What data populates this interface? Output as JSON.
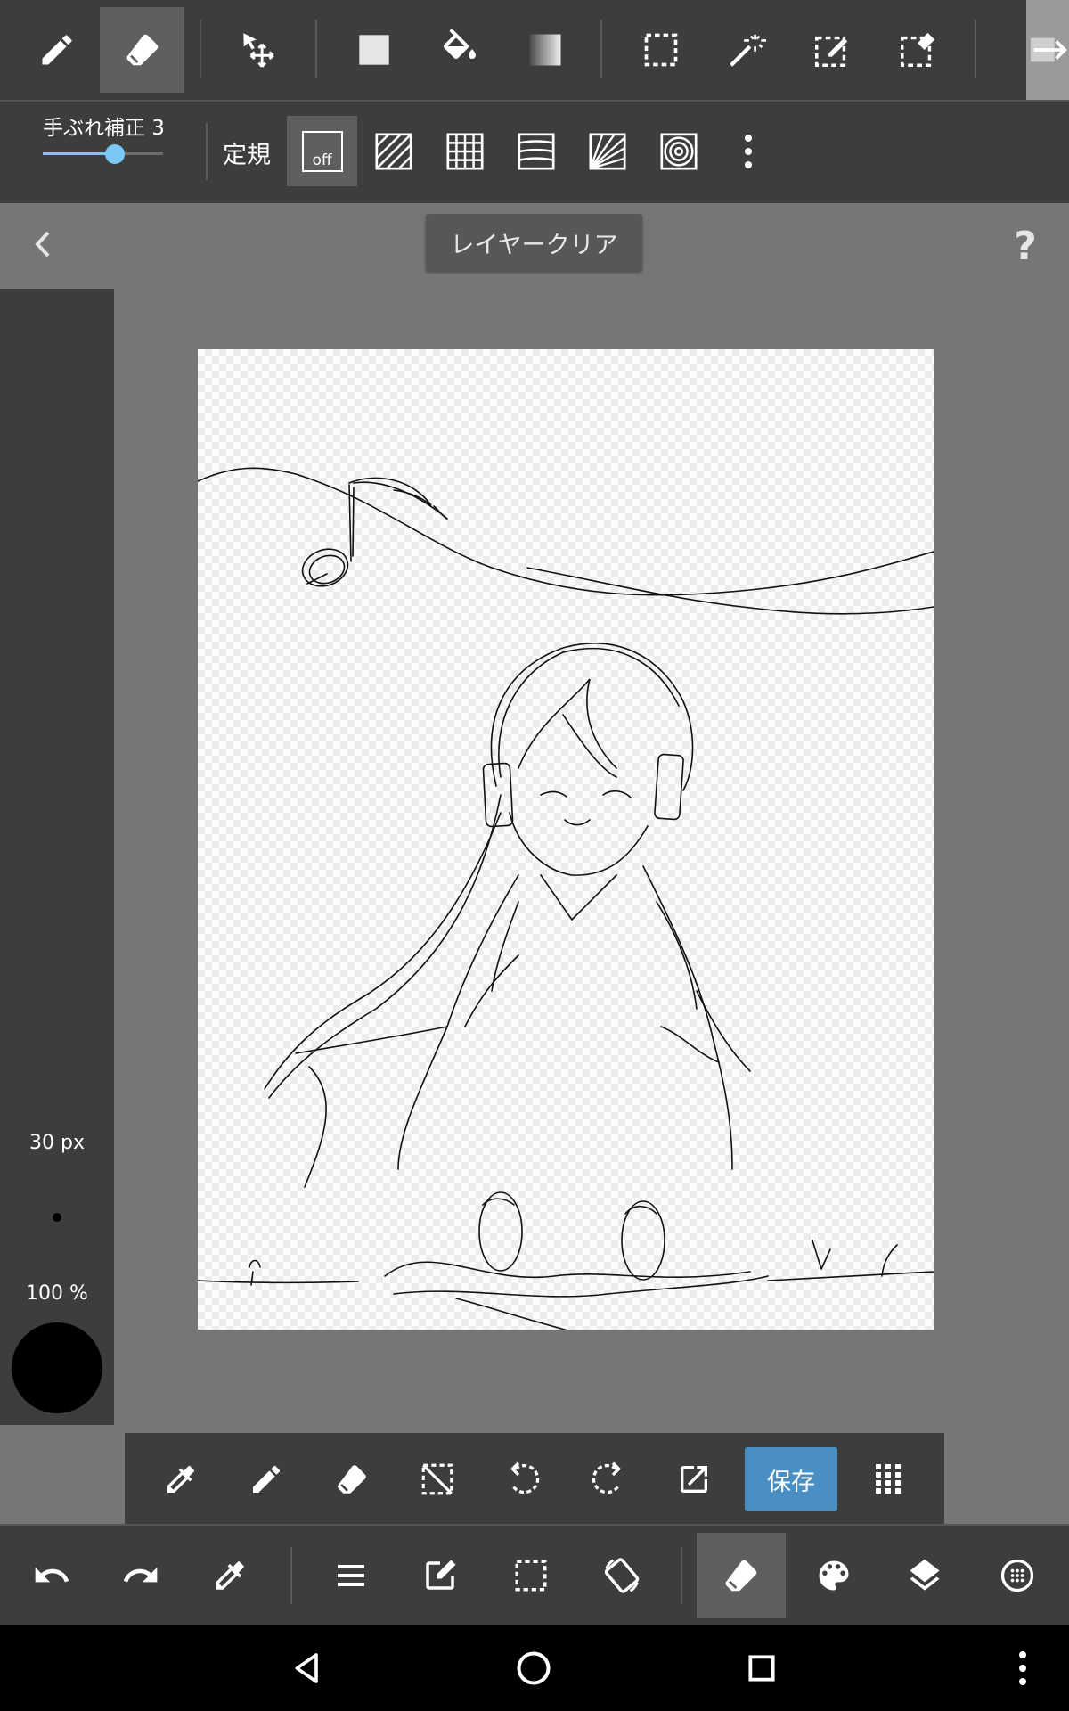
{
  "top_toolbar": {
    "tools": [
      "pen-tool",
      "eraser-tool",
      "move-tool",
      "fill-rect-tool",
      "bucket-tool",
      "gradient-tool",
      "select-tool",
      "magic-wand-tool",
      "select-pen-tool",
      "select-eraser-tool",
      "transform-tool"
    ],
    "active_tool": "eraser-tool"
  },
  "sub_toolbar": {
    "stabilizer_label": "手ぶれ補正 3",
    "stabilizer_value": 3,
    "stabilizer_fraction": 0.6,
    "ruler_label": "定規",
    "ruler_off_label": "off"
  },
  "header": {
    "clear_layer_button": "レイヤークリア"
  },
  "brush_panel": {
    "size_label": "30 px",
    "opacity_label": "100 %",
    "color": "#000000"
  },
  "quick_bar": {
    "save_label": "保存"
  },
  "colors": {
    "toolbar_bg": "#3d3d3d",
    "workspace_bg": "#767676",
    "accent": "#79c8f5",
    "save_button": "#4a8fc4"
  }
}
